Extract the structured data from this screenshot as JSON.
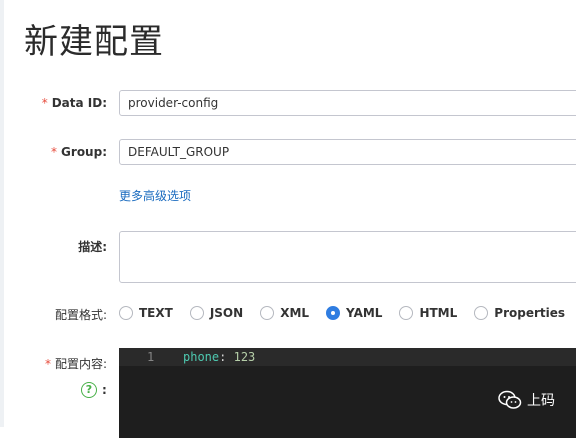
{
  "page": {
    "title": "新建配置"
  },
  "form": {
    "data_id": {
      "label": "Data ID:",
      "value": "provider-config"
    },
    "group": {
      "label": "Group:",
      "value": "DEFAULT_GROUP"
    },
    "more_options": "更多高级选项",
    "description": {
      "label": "描述:",
      "value": ""
    },
    "format": {
      "label": "配置格式:",
      "options": [
        "TEXT",
        "JSON",
        "XML",
        "YAML",
        "HTML",
        "Properties"
      ],
      "selected": "YAML"
    },
    "content": {
      "label": "配置内容:",
      "help_colon": ":",
      "line_number": "1",
      "code_key": "phone",
      "code_sep": ":",
      "code_value": "123"
    },
    "required_mark": "*"
  },
  "watermark": {
    "text": "上码",
    "icon": "wechat-icon"
  },
  "colors": {
    "accent": "#2f7de1",
    "required": "#e74c3c",
    "link": "#1a6bbf",
    "editor_bg": "#1e1e1e"
  }
}
